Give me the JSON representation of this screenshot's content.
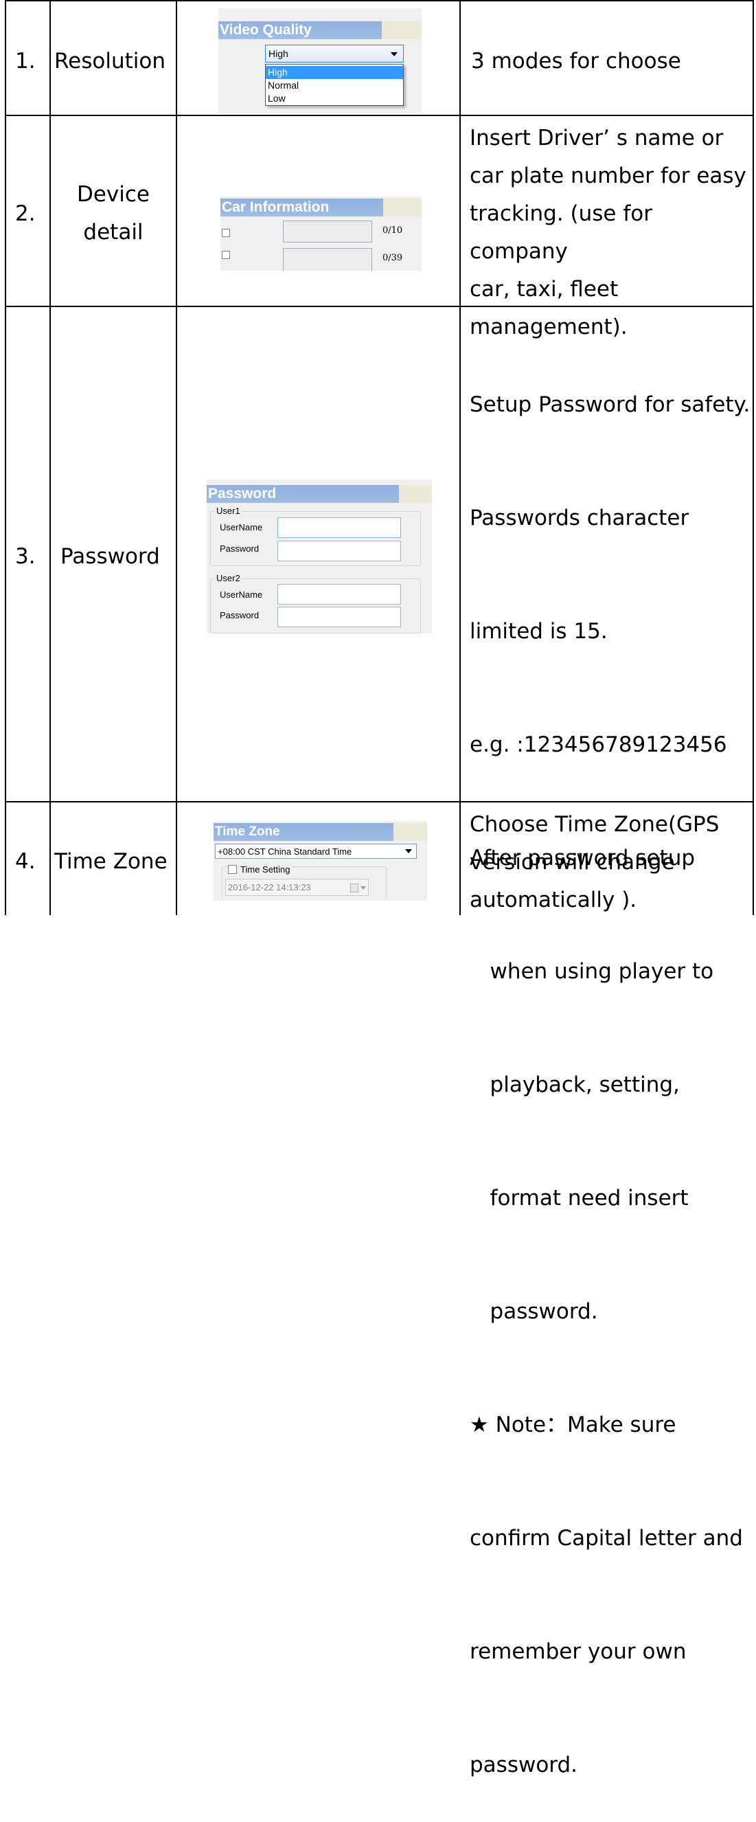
{
  "rows": [
    {
      "num": "1.",
      "name": "Resolution",
      "desc_lines": [
        "3 modes for choose"
      ]
    },
    {
      "num": "2.",
      "name_lines": [
        "Device",
        "detail"
      ],
      "desc_lines": [
        "Insert Driver’  s name or",
        "car plate number for easy",
        "tracking. (use for company",
        "car, taxi, fleet",
        "management)."
      ]
    },
    {
      "num": "3.",
      "name": "Password",
      "desc_lines": [
        "Setup Password for safety.",
        "Passwords character",
        "limited is 15.",
        "e.g. :123456789123456",
        "After password setup",
        "   when using player to",
        "   playback, setting,",
        "   format need insert",
        "   password.",
        "★ Note：Make sure",
        "confirm Capital letter and",
        "remember your own",
        "password."
      ]
    },
    {
      "num": "4.",
      "name": "Time Zone",
      "desc_lines": [
        "Choose Time Zone(GPS",
        "version will change",
        "automatically )."
      ]
    }
  ],
  "video_quality": {
    "title": "Video Quality",
    "selected": "High",
    "options": [
      "High",
      "Normal",
      "Low"
    ]
  },
  "car_info": {
    "title": "Car Information",
    "fields": [
      {
        "counter": "0/10"
      },
      {
        "counter": "0/39"
      }
    ]
  },
  "password_panel": {
    "title": "Password",
    "groups": [
      {
        "legend": "User1",
        "username_label": "UserName",
        "password_label": "Password"
      },
      {
        "legend": "User2",
        "username_label": "UserName",
        "password_label": "Password"
      }
    ]
  },
  "time_zone": {
    "title": "Time Zone",
    "selected": "+08:00 CST China Standard Time",
    "time_setting_label": "Time Setting",
    "datetime_value": "2016-12-22 14:13:23"
  }
}
